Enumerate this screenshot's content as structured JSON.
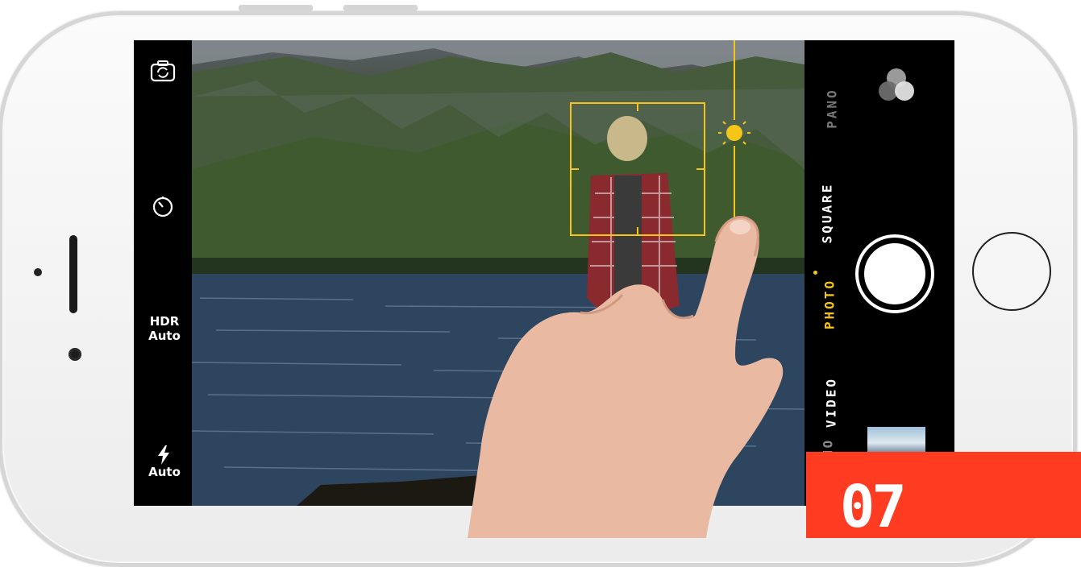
{
  "camera": {
    "left_bar": {
      "flip_icon": "camera-flip-icon",
      "timer_icon": "timer-icon",
      "hdr": {
        "line1": "HDR",
        "line2": "Auto"
      },
      "flash": {
        "icon": "flash-icon",
        "label": "Auto"
      }
    },
    "modes": [
      "PANO",
      "SQUARE",
      "PHOTO",
      "VIDEO",
      "SLO-MO"
    ],
    "selected_mode": "PHOTO",
    "right_bar": {
      "filters_icon": "filters-icon",
      "shutter": "shutter-button",
      "thumbnail": "last-photo-thumbnail"
    },
    "focus_box": {
      "icon": "focus-square-icon",
      "exposure_icon": "sun-exposure-icon"
    }
  },
  "badge": {
    "number": "07"
  },
  "colors": {
    "accent": "#f5c518",
    "badge": "#ff3b22",
    "phone": "#f2f2f2"
  }
}
